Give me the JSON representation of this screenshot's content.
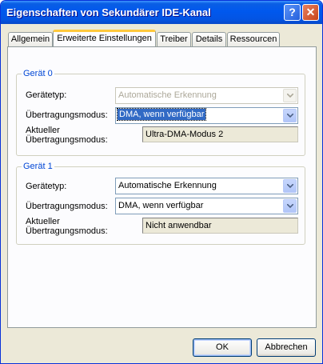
{
  "window": {
    "title": "Eigenschaften von Sekundärer IDE-Kanal",
    "help_symbol": "?",
    "close_symbol": "✕"
  },
  "tabs": [
    {
      "label": "Allgemein",
      "active": false
    },
    {
      "label": "Erweiterte Einstellungen",
      "active": true
    },
    {
      "label": "Treiber",
      "active": false
    },
    {
      "label": "Details",
      "active": false
    },
    {
      "label": "Ressourcen",
      "active": false
    }
  ],
  "device0": {
    "group_label": "Gerät 0",
    "device_type_label": "Gerätetyp:",
    "device_type_value": "Automatische Erkennung",
    "transfer_mode_label": "Übertragungsmodus:",
    "transfer_mode_value": "DMA, wenn verfügbar",
    "current_mode_label_1": "Aktueller",
    "current_mode_label_2": "Übertragungsmodus:",
    "current_mode_value": "Ultra-DMA-Modus 2"
  },
  "device1": {
    "group_label": "Gerät 1",
    "device_type_label": "Gerätetyp:",
    "device_type_value": "Automatische Erkennung",
    "transfer_mode_label": "Übertragungsmodus:",
    "transfer_mode_value": "DMA, wenn verfügbar",
    "current_mode_label_1": "Aktueller",
    "current_mode_label_2": "Übertragungsmodus:",
    "current_mode_value": "Nicht anwendbar"
  },
  "buttons": {
    "ok": "OK",
    "cancel": "Abbrechen"
  },
  "colors": {
    "titlebar": "#0058ee",
    "group_label": "#0046d5",
    "selection": "#316ac5",
    "tab_highlight": "#ffc83c"
  }
}
